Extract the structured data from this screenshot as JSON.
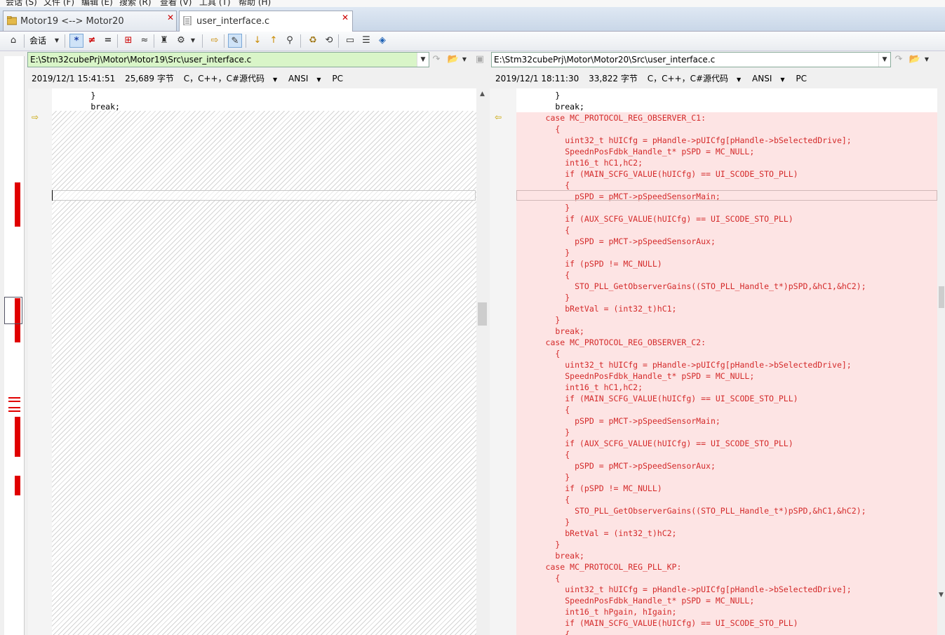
{
  "menu": [
    "会话 (S)",
    "文件 (F)",
    "编辑 (E)",
    "搜索 (R)",
    "查看 (V)",
    "工具 (T)",
    "帮助 (H)"
  ],
  "tabs": [
    {
      "label": "Motor19 <--> Motor20",
      "active": false
    },
    {
      "label": "user_interface.c",
      "active": true
    }
  ],
  "toolbar": {
    "session_label": "会话"
  },
  "left": {
    "path": "E:\\Stm32cubePrj\\Motor\\Motor19\\Src\\user_interface.c",
    "path_bg": "#d9f5c8",
    "date": "2019/12/1 15:41:51",
    "size": "25,689 字节",
    "lang": "C，C++，C#源代码",
    "encoding": "ANSI",
    "lineend": "PC",
    "code": [
      "        }",
      "        break;"
    ]
  },
  "right": {
    "path": "E:\\Stm32cubePrj\\Motor\\Motor20\\Src\\user_interface.c",
    "date": "2019/12/1 18:11:30",
    "size": "33,822 字节",
    "lang": "C，C++，C#源代码",
    "encoding": "ANSI",
    "lineend": "PC",
    "context_lines": [
      "        }",
      "        break;"
    ],
    "diff_lines": [
      "      case MC_PROTOCOL_REG_OBSERVER_C1:",
      "        {",
      "          uint32_t hUICfg = pHandle->pUICfg[pHandle->bSelectedDrive];",
      "          SpeednPosFdbk_Handle_t* pSPD = MC_NULL;",
      "          int16_t hC1,hC2;",
      "          if (MAIN_SCFG_VALUE(hUICfg) == UI_SCODE_STO_PLL)",
      "          {",
      "            pSPD = pMCT->pSpeedSensorMain;",
      "          }",
      "          if (AUX_SCFG_VALUE(hUICfg) == UI_SCODE_STO_PLL)",
      "          {",
      "            pSPD = pMCT->pSpeedSensorAux;",
      "          }",
      "          if (pSPD != MC_NULL)",
      "          {",
      "            STO_PLL_GetObserverGains((STO_PLL_Handle_t*)pSPD,&hC1,&hC2);",
      "          }",
      "          bRetVal = (int32_t)hC1;",
      "        }",
      "        break;",
      "      case MC_PROTOCOL_REG_OBSERVER_C2:",
      "        {",
      "          uint32_t hUICfg = pHandle->pUICfg[pHandle->bSelectedDrive];",
      "          SpeednPosFdbk_Handle_t* pSPD = MC_NULL;",
      "          int16_t hC1,hC2;",
      "          if (MAIN_SCFG_VALUE(hUICfg) == UI_SCODE_STO_PLL)",
      "          {",
      "            pSPD = pMCT->pSpeedSensorMain;",
      "          }",
      "          if (AUX_SCFG_VALUE(hUICfg) == UI_SCODE_STO_PLL)",
      "          {",
      "            pSPD = pMCT->pSpeedSensorAux;",
      "          }",
      "          if (pSPD != MC_NULL)",
      "          {",
      "            STO_PLL_GetObserverGains((STO_PLL_Handle_t*)pSPD,&hC1,&hC2);",
      "          }",
      "          bRetVal = (int32_t)hC2;",
      "        }",
      "        break;",
      "      case MC_PROTOCOL_REG_PLL_KP:",
      "        {",
      "          uint32_t hUICfg = pHandle->pUICfg[pHandle->bSelectedDrive];",
      "          SpeednPosFdbk_Handle_t* pSPD = MC_NULL;",
      "          int16_t hPgain, hIgain;",
      "          if (MAIN_SCFG_VALUE(hUICfg) == UI_SCODE_STO_PLL)",
      "          {"
    ]
  },
  "colors": {
    "diff_text": "#d42a2a",
    "diff_bg": "#fde4e4",
    "overview_mark": "#e00000"
  }
}
